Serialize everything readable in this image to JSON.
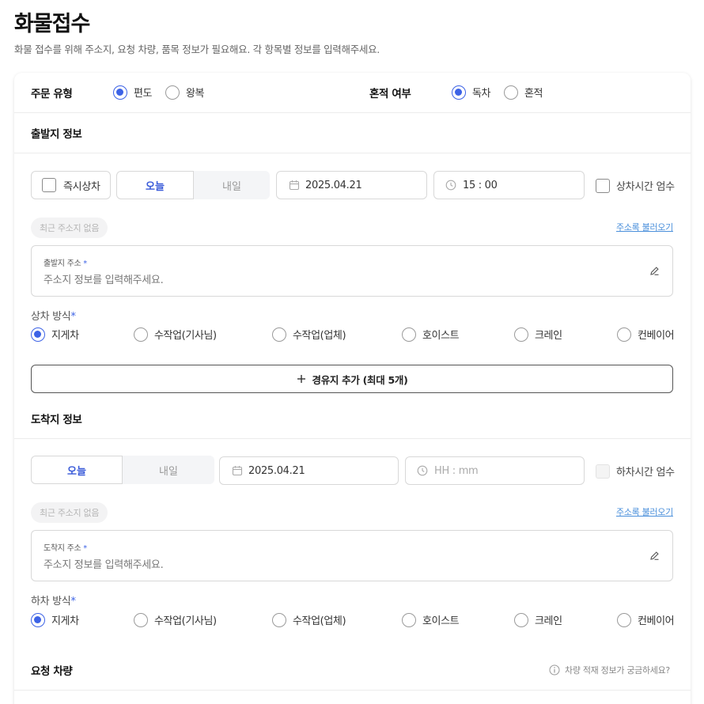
{
  "page": {
    "title": "화물접수",
    "subtitle": "화물 접수를 위해 주소지, 요청 차량, 품목 정보가 필요해요. 각 항목별 정보를 입력해주세요."
  },
  "order_type": {
    "label": "주문 유형",
    "options": [
      "편도",
      "왕복"
    ],
    "selected": "편도"
  },
  "mixed": {
    "label": "혼적 여부",
    "options": [
      "독차",
      "혼적"
    ],
    "selected": "독차"
  },
  "departure": {
    "section_title": "출발지 정보",
    "immediate_label": "즉시상차",
    "day_tabs": [
      "오늘",
      "내일"
    ],
    "date_value": "2025.04.21",
    "time_value": "15 : 00",
    "strict_label": "상차시간 엄수",
    "recent_pill": "최근 주소지 없음",
    "address_book_link": "주소록 불러오기",
    "address_label": "출발지 주소",
    "address_placeholder": "주소지 정보를 입력해주세요.",
    "method_label": "상차 방식",
    "methods": [
      "지게차",
      "수작업(기사님)",
      "수작업(업체)",
      "호이스트",
      "크레인",
      "컨베이어"
    ],
    "method_selected": "지게차",
    "add_waypoint": "경유지 추가 (최대 5개)"
  },
  "arrival": {
    "section_title": "도착지 정보",
    "day_tabs": [
      "오늘",
      "내일"
    ],
    "date_value": "2025.04.21",
    "time_placeholder": "HH : mm",
    "strict_label": "하차시간 엄수",
    "recent_pill": "최근 주소지 없음",
    "address_book_link": "주소록 불러오기",
    "address_label": "도착지 주소",
    "address_placeholder": "주소지 정보를 입력해주세요.",
    "method_label": "하차 방식",
    "methods": [
      "지게차",
      "수작업(기사님)",
      "수작업(업체)",
      "호이스트",
      "크레인",
      "컨베이어"
    ],
    "method_selected": "지게차"
  },
  "vehicle": {
    "section_title": "요청 차량",
    "help_text": "차량 적재 정보가 궁금하세요?"
  },
  "colors": {
    "accent": "#3d63e6",
    "link": "#4a8fdb"
  }
}
